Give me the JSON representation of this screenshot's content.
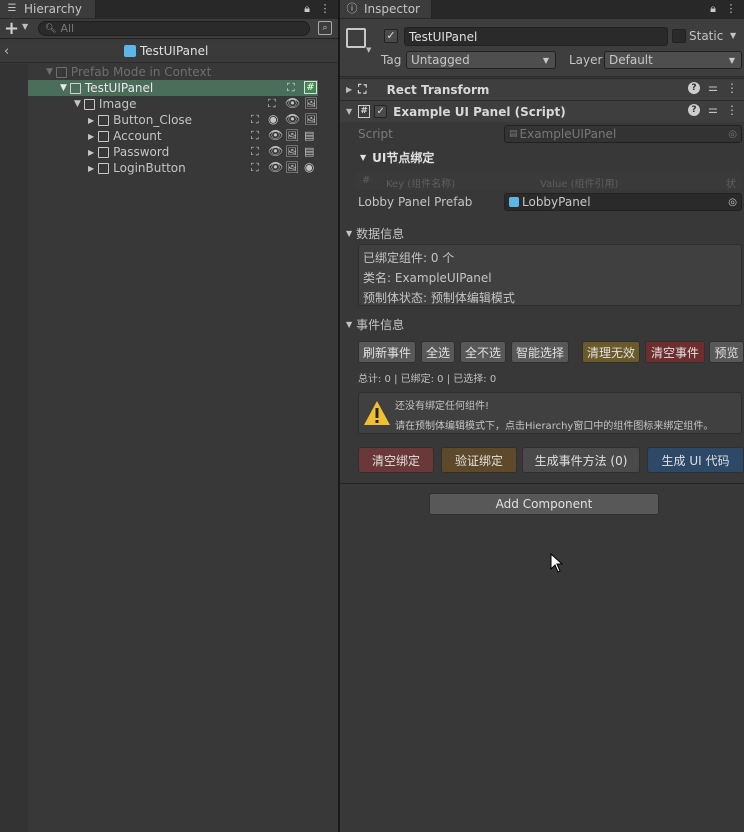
{
  "hierarchy": {
    "tab_title": "Hierarchy",
    "search_placeholder": "All",
    "prefab_title": "TestUIPanel",
    "items": [
      {
        "label": "Prefab Mode in Context"
      },
      {
        "label": "TestUIPanel"
      },
      {
        "label": "Image"
      },
      {
        "label": "Button_Close"
      },
      {
        "label": "Account"
      },
      {
        "label": "Password"
      },
      {
        "label": "LoginButton"
      }
    ],
    "script_badge": "#"
  },
  "inspector": {
    "tab_title": "Inspector",
    "object_name": "TestUIPanel",
    "static_label": "Static",
    "tag_label": "Tag",
    "tag_value": "Untagged",
    "layer_label": "Layer",
    "layer_value": "Default",
    "components": {
      "rect_transform": "Rect Transform",
      "script_component": "Example UI Panel (Script)"
    },
    "script_label": "Script",
    "script_value": "ExampleUIPanel",
    "binding_section": "UI节点绑定",
    "table_headers": {
      "hash": "#",
      "key": "Key (组件名称)",
      "value": "Value (组件引用)",
      "status": "状"
    },
    "lobby_label": "Lobby Panel Prefab",
    "lobby_value": "LobbyPanel",
    "data_section": "数据信息",
    "data_lines": [
      "已绑定组件: 0 个",
      "类名: ExampleUIPanel",
      "预制体状态: 预制体编辑模式"
    ],
    "event_section": "事件信息",
    "event_buttons": {
      "refresh": "刷新事件",
      "select_all": "全选",
      "select_none": "全不选",
      "smart_select": "智能选择",
      "clean_invalid": "清理无效",
      "clear_events": "清空事件",
      "preview": "预览"
    },
    "stats": "总计: 0 | 已绑定: 0 | 已选择: 0",
    "warning_line1": "还没有绑定任何组件!",
    "warning_line2": "请在预制体编辑模式下，点击Hierarchy窗口中的组件图标来绑定组件。",
    "action_buttons": {
      "clear_binding": "清空绑定",
      "validate_binding": "验证绑定",
      "gen_event_methods": "生成事件方法 (0)",
      "gen_ui_code": "生成 UI 代码"
    },
    "add_component": "Add Component"
  },
  "colors": {
    "selected_row": "#4b6e5a",
    "clean_invalid_bg": "#6b5a2a",
    "clear_events_bg": "#6e2e2e",
    "clear_binding_bg": "#6a3838",
    "validate_binding_bg": "#5e4a2a",
    "gen_ui_bg": "#2e4868",
    "warning_yellow": "#f0c030",
    "prefab_blue": "#5cb6e8"
  }
}
